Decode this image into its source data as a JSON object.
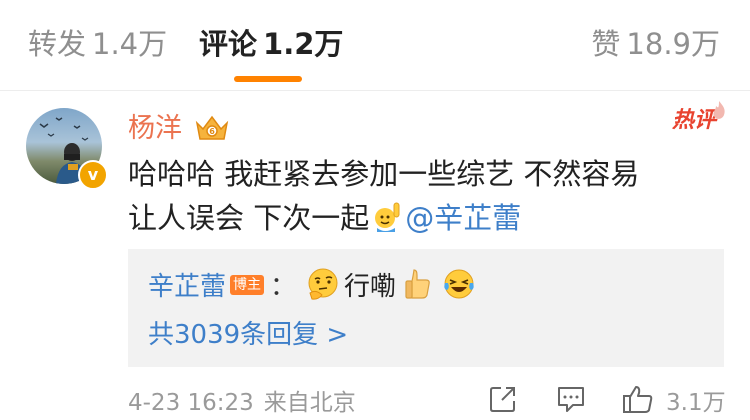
{
  "tabs": {
    "repost": {
      "label": "转发",
      "count": "1.4万"
    },
    "comments": {
      "label": "评论",
      "count": "1.2万"
    },
    "likes": {
      "label": "赞",
      "count": "18.9万"
    }
  },
  "colors": {
    "accent": "#ff8200",
    "username": "#eb7350",
    "link": "#3e7fc9",
    "hot": "#e8432f",
    "reply_bg": "#f2f2f2"
  },
  "comment": {
    "username": "杨洋",
    "hot_badge": "热评",
    "verified_icon": "v",
    "text_line1": "哈哈哈 我赶紧去参加一些综艺 不然容易",
    "text_line2": "让人误会 下次一起",
    "mention": "@辛芷蕾",
    "emoji_icon": "raising-hand-emoji"
  },
  "reply": {
    "author": "辛芷蕾",
    "author_badge": "博主",
    "colon": "：",
    "text": "行嘞",
    "emojis": [
      "thinking-emoji",
      "thumbs-up-emoji",
      "laughing-tears-emoji"
    ],
    "more_label": "共3039条回复 >"
  },
  "footer": {
    "time": "4-23 16:23",
    "source": "来自北京",
    "like_count": "3.1万"
  }
}
